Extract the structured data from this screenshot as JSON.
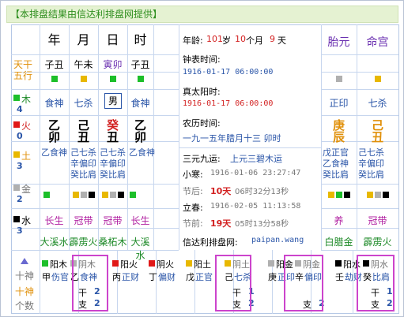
{
  "header": {
    "title": "【本排盘结果由信达利排盘网提供】"
  },
  "columns": {
    "year": "年",
    "month": "月",
    "day": "日",
    "hour": "时",
    "taiyuan": "胎元",
    "minggong": "命宫"
  },
  "left": {
    "tiangan": "天干",
    "wuxing": "五行",
    "elements": [
      {
        "name": "木",
        "count": "4",
        "color": "#1dbf2a"
      },
      {
        "name": "火",
        "count": "0",
        "color": "#e01818"
      },
      {
        "name": "土",
        "count": "3",
        "color": "#e8b800"
      },
      {
        "name": "金",
        "count": "2",
        "color": "#b0b0b0"
      },
      {
        "name": "水",
        "count": "3",
        "color": "#000000"
      }
    ],
    "shishen_label": "十神",
    "shishen2_label": "十神",
    "geshu_label": "个数"
  },
  "pillars": [
    {
      "nayin_top": "子丑",
      "dot": "#1dbf2a",
      "shen": "食神",
      "gan": "乙",
      "zhi": "卯",
      "hidden": [
        "乙食神"
      ],
      "dots2": [
        "#1dbf2a"
      ],
      "stage": "长生",
      "nayin": "大溪水"
    },
    {
      "nayin_top": "午未",
      "dot": "#e8b800",
      "shen": "七杀",
      "gan": "己",
      "zhi": "丑",
      "hidden": [
        "己七杀",
        "辛偏印",
        "癸比肩"
      ],
      "dots2": [
        "#e8b800",
        "#b0b0b0",
        "#000000"
      ],
      "stage": "冠带",
      "nayin": "霹雳火"
    },
    {
      "nayin_top": "寅卯",
      "dot": "#1dbf2a",
      "shen": "男",
      "gan": "癸",
      "zhi": "丑",
      "hidden": [
        "己七杀",
        "辛偏印",
        "癸比肩"
      ],
      "dots2": [
        "#e8b800",
        "#b0b0b0",
        "#000000"
      ],
      "stage": "冠带",
      "nayin": "桑柘木"
    },
    {
      "nayin_top": "子丑",
      "dot": "#1dbf2a",
      "shen": "食神",
      "gan": "乙",
      "zhi": "卯",
      "hidden": [
        "乙食神"
      ],
      "dots2": [
        "#1dbf2a"
      ],
      "stage": "长生",
      "nayin": "大溪水"
    }
  ],
  "info": {
    "age_label": "年龄:",
    "age_y": "101",
    "age_y_unit": "岁",
    "age_m": "10",
    "age_m_unit": "个月",
    "age_d": "9",
    "age_d_unit": "天",
    "clock_label": "钟表时间:",
    "clock_val": "1916-01-17 06:00:00",
    "solar_label": "真太阳时:",
    "solar_val": "1916-01-17 06:00:00",
    "lunar_label": "农历时间:",
    "lunar_val": "一九一五年腊月十三 卯时",
    "sanyuan_label": "三元九运:",
    "sanyuan_val": "上元三碧木运",
    "xiaohan_label": "小寒:",
    "xiaohan_val": "1916-01-06 23:27:47",
    "lichun_label": "立春:",
    "lichun_val": "1916-02-05 11:13:58",
    "jiehou_label": "节后:",
    "jiehou_d": "10天",
    "jiehou_rest": "06时32分13秒",
    "jieqian_label": "节前:",
    "jieqian_d": "19天",
    "jieqian_rest": "05时13分58秒",
    "site_label": "信达利排盘网:",
    "site_val": "paipan.wang"
  },
  "taiyuan": {
    "dot": "#b0b0b0",
    "shen": "正印",
    "gan": "庚",
    "zhi": "辰",
    "hidden": [
      "戊正官",
      "乙食神",
      "癸比肩"
    ],
    "dots2": [
      "#e8b800",
      "#1dbf2a",
      "#000000"
    ],
    "stage": "养",
    "nayin": "白腊金"
  },
  "minggong": {
    "dot": "#e8b800",
    "shen": "七杀",
    "gan": "己",
    "zhi": "丑",
    "hidden": [
      "己七杀",
      "辛偏印",
      "癸比肩"
    ],
    "dots2": [
      "#e8b800",
      "#b0b0b0",
      "#000000"
    ],
    "stage": "冠带",
    "nayin": "霹雳火"
  },
  "bottom": [
    {
      "dot": "#1dbf2a",
      "top": "阳木",
      "sub1": "甲",
      "sub2": "伤官",
      "hl": false
    },
    {
      "dot": "#b0b0b0",
      "top": "阴木",
      "sub1": "乙",
      "sub2": "食神",
      "gan": "干",
      "gan_n": "2",
      "zhi": "支",
      "zhi_n": "2",
      "hl": true
    },
    {
      "dot": "#e01818",
      "top": "阳火",
      "sub1": "丙",
      "sub2": "正财",
      "hl": false
    },
    {
      "dot": "#e01818",
      "top": "阴火",
      "sub1": "丁",
      "sub2": "偏财",
      "hl": false
    },
    {
      "dot": "#e8b800",
      "top": "阳土",
      "sub1": "戊",
      "sub2": "正官",
      "hl": false
    },
    {
      "dot": "#e8b800",
      "top": "阴土",
      "sub1": "己",
      "sub2": "七杀",
      "gan": "干",
      "gan_n": "1",
      "zhi": "支",
      "zhi_n": "2",
      "hl": true
    },
    {
      "dot": "#b0b0b0",
      "top": "阳金",
      "sub1": "庚",
      "sub2": "正印",
      "hl": false
    },
    {
      "dot": "#b0b0b0",
      "top": "阴金",
      "sub1": "辛",
      "sub2": "偏印",
      "zhi": "支",
      "zhi_n": "2",
      "hl": true
    },
    {
      "dot": "#000000",
      "top": "阳水",
      "sub1": "壬",
      "sub2": "劫财",
      "hl": false
    },
    {
      "dot": "#000000",
      "top": "阴水",
      "sub1": "癸",
      "sub2": "比肩",
      "gan": "干",
      "gan_n": "1",
      "zhi": "支",
      "zhi_n": "2",
      "hl": true
    }
  ]
}
